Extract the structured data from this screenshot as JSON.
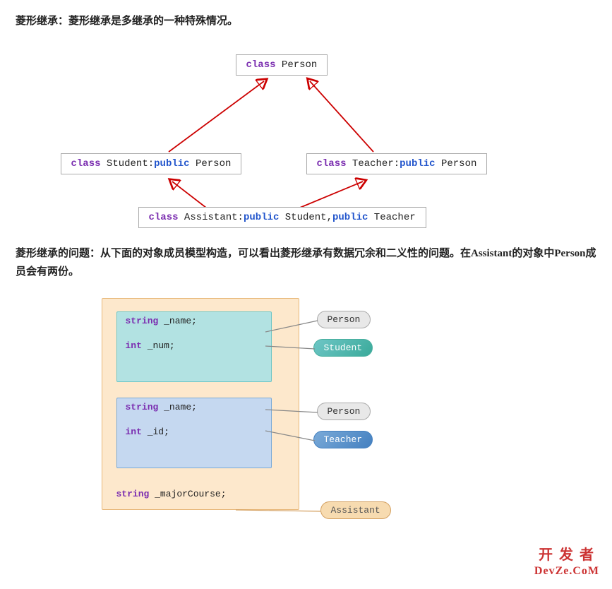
{
  "intro": {
    "text": "菱形继承：菱形继承是多继承的一种特殊情况。"
  },
  "diagram": {
    "person_box": "class Person",
    "student_box_kw": "class",
    "student_box_kw2": "public",
    "student_box_text": " Student:",
    "student_box_end": " Person",
    "teacher_box_kw": "class",
    "teacher_box_kw2": "public",
    "teacher_box_text": " Teacher:",
    "teacher_box_end": " Person",
    "assistant_kw1": "class",
    "assistant_kw2": "public",
    "assistant_kw3": "public",
    "assistant_text1": " Assistant:",
    "assistant_text2": " Student,",
    "assistant_text3": " Teacher"
  },
  "problem": {
    "text": "菱形继承的问题：从下面的对象成员模型构造，可以看出菱形继承有数据冗余和二义性的问题。在Assistant的对象中Person成员会有两份。"
  },
  "model": {
    "teal_line1_kw": "string",
    "teal_line1": " _name;",
    "teal_line2_kw": "int",
    "teal_line2": " _num;",
    "blue_line1_kw": "string",
    "blue_line1": " _name;",
    "blue_line2_kw": "int",
    "blue_line2": " _id;",
    "bottom_line_kw": "string",
    "bottom_line": " _majorCourse;",
    "label_person1": "Person",
    "label_student": "Student",
    "label_person2": "Person",
    "label_teacher": "Teacher",
    "label_assistant": "Assistant"
  },
  "branding": {
    "line1": "开 发 者",
    "line2": "DevZe.CoM"
  }
}
